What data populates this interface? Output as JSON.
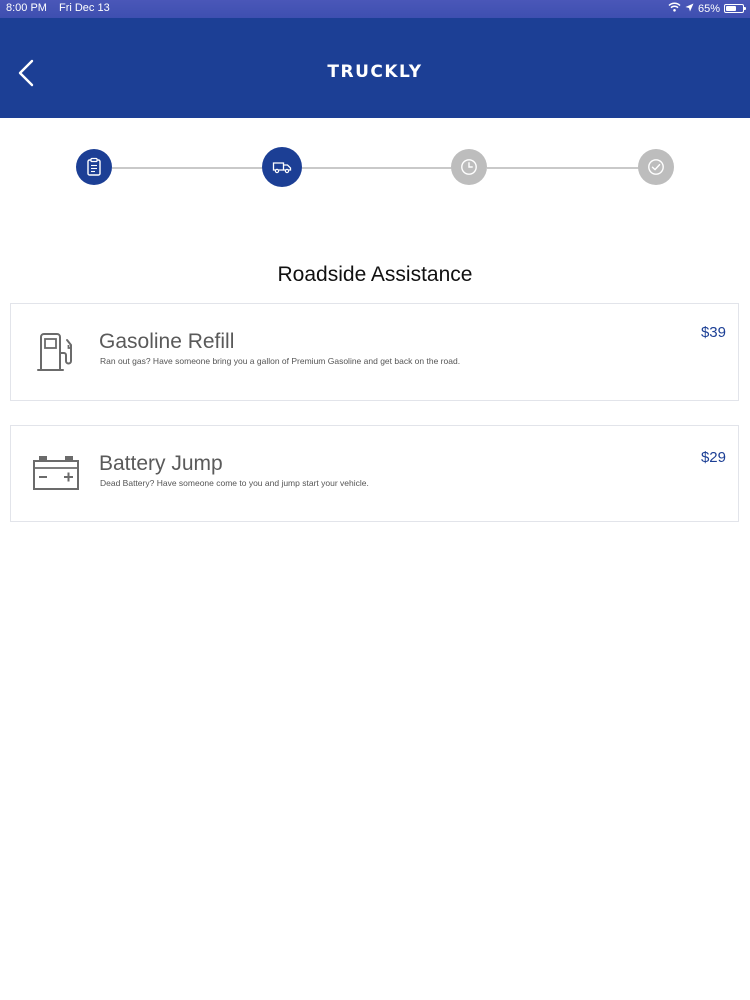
{
  "status_bar": {
    "time": "8:00 PM",
    "date": "Fri Dec 13",
    "battery": "65%",
    "battery_level": 0.65
  },
  "header": {
    "logo_text": "TRUCKLY",
    "back_icon": "chevron-left-icon",
    "background_color": "#1c3f95"
  },
  "stepper": {
    "steps": [
      {
        "icon": "clipboard-icon",
        "state": "active"
      },
      {
        "icon": "truck-icon",
        "state": "active"
      },
      {
        "icon": "clock-icon",
        "state": "inactive"
      },
      {
        "icon": "check-circle-icon",
        "state": "inactive"
      }
    ],
    "active_color": "#1c3f95",
    "inactive_color": "#bdbdbd"
  },
  "main": {
    "title": "Roadside Assistance",
    "services": [
      {
        "icon": "gas-pump-icon",
        "title": "Gasoline Refill",
        "description": "Ran out gas? Have someone bring you a gallon of Premium Gasoline and get back on the road.",
        "price": "$39"
      },
      {
        "icon": "car-battery-icon",
        "title": "Battery Jump",
        "description": "Dead Battery? Have someone come to you and jump start your vehicle.",
        "price": "$29"
      }
    ]
  }
}
